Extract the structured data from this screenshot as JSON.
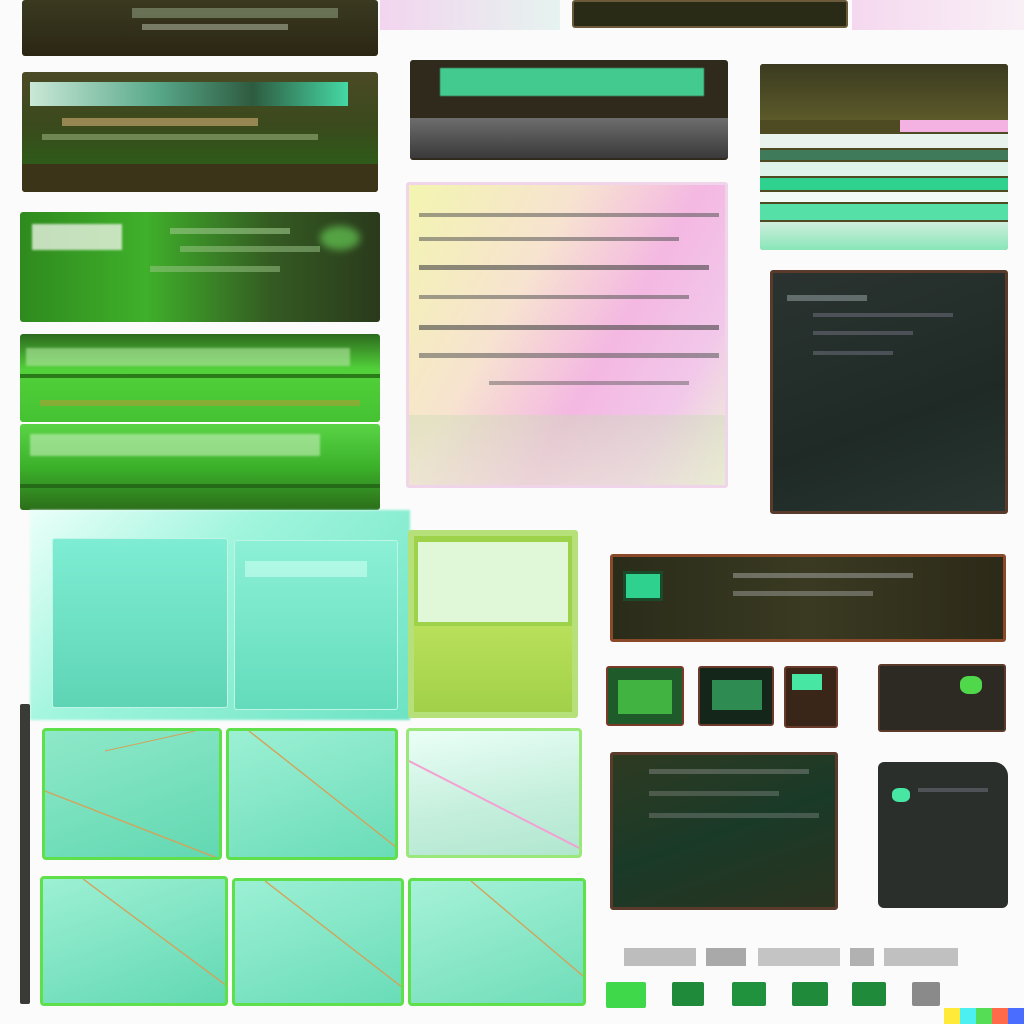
{
  "palette": {
    "background": "#fbfbfb",
    "dark_olive": "#2c2a16",
    "leaf_green": "#3fb02a",
    "mint": "#47e6a3",
    "aqua": "#5ee0c0",
    "pink": "#f0a0d8",
    "charcoal": "#2b2f2c"
  },
  "corner_mark": {
    "colors": [
      "#ffea3a",
      "#4cf0f0",
      "#55dd55",
      "#ff6b4a",
      "#4a6cff"
    ]
  }
}
